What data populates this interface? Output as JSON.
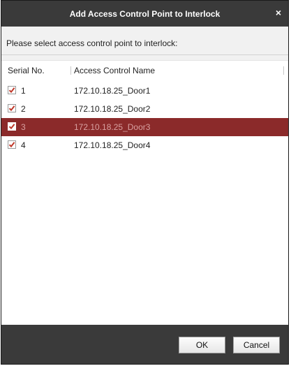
{
  "dialog": {
    "title": "Add Access Control Point to Interlock",
    "close_glyph": "×",
    "prompt": "Please select access control point to interlock:"
  },
  "table": {
    "columns": [
      "Serial No.",
      "Access Control Name"
    ],
    "rows": [
      {
        "serial": "1",
        "name": "172.10.18.25_Door1",
        "checked": true,
        "selected": false
      },
      {
        "serial": "2",
        "name": "172.10.18.25_Door2",
        "checked": true,
        "selected": false
      },
      {
        "serial": "3",
        "name": "172.10.18.25_Door3",
        "checked": true,
        "selected": true
      },
      {
        "serial": "4",
        "name": "172.10.18.25_Door4",
        "checked": true,
        "selected": false
      }
    ]
  },
  "buttons": {
    "ok": "OK",
    "cancel": "Cancel"
  },
  "colors": {
    "titlebar": "#3a3a3a",
    "selected_row": "#8b2a2a",
    "checkmark": "#c0392b"
  },
  "icons": {
    "close": "close-icon",
    "checkbox": "checkbox-checked-icon"
  }
}
